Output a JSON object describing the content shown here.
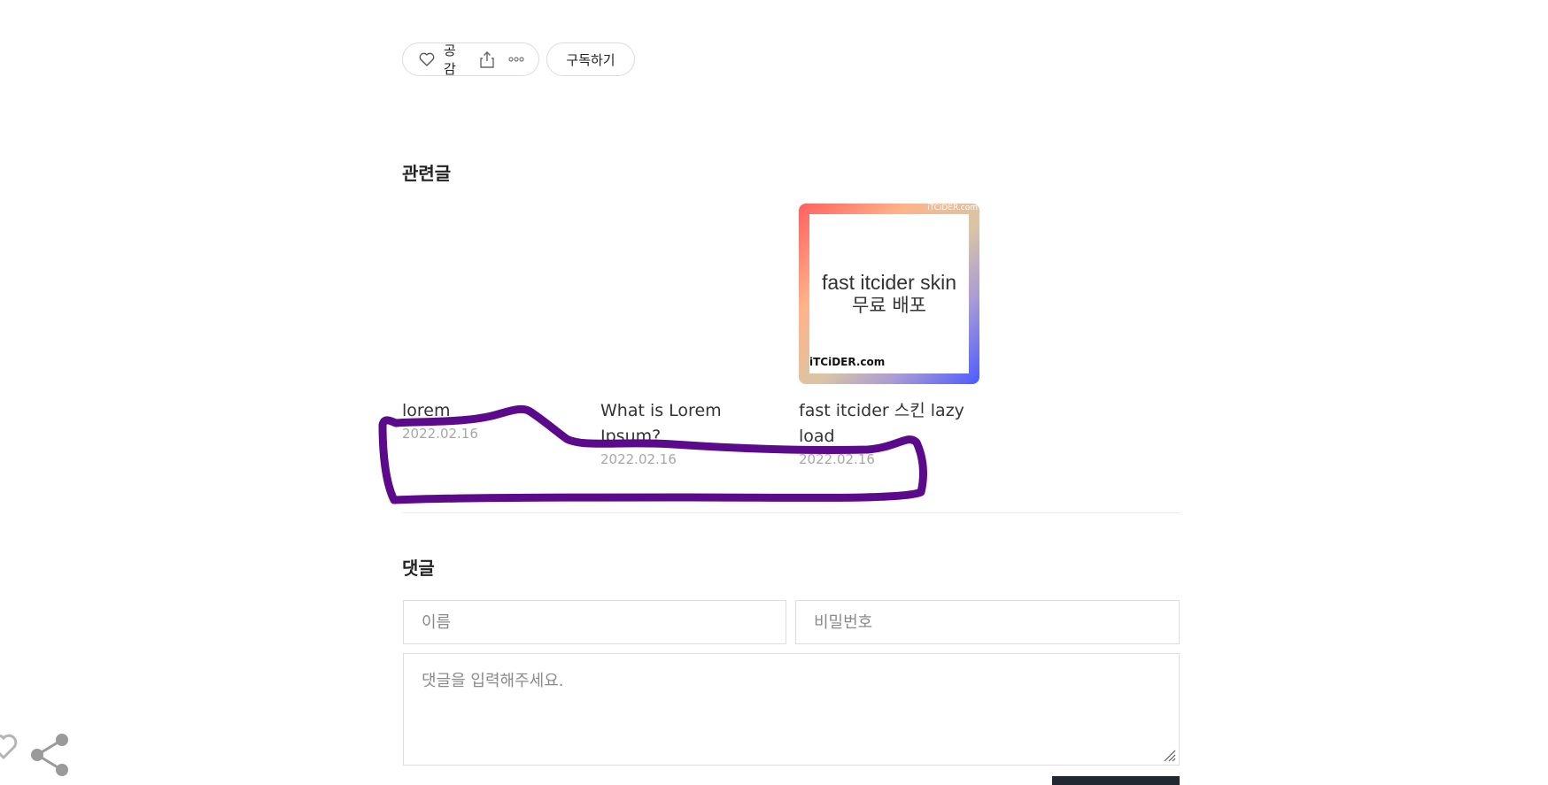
{
  "actions": {
    "like_label": "공감",
    "subscribe_label": "구독하기"
  },
  "related": {
    "title": "관련글",
    "items": [
      {
        "title": "lorem",
        "date": "2022.02.16",
        "has_thumbnail": false
      },
      {
        "title": "What is Lorem Ipsum?",
        "date": "2022.02.16",
        "has_thumbnail": false
      },
      {
        "title": "fast itcider 스킨 lazy load",
        "date": "2022.02.16",
        "has_thumbnail": true,
        "thumbnail": {
          "line1": "fast itcider skin",
          "line2": "무료 배포",
          "brand": "iTCiDER.com"
        }
      }
    ]
  },
  "comments": {
    "title": "댓글",
    "name_placeholder": "이름",
    "password_placeholder": "비밀번호",
    "textarea_placeholder": "댓글을 입력해주세요."
  },
  "colors": {
    "annotation_stroke": "#5a0a8a",
    "submit_button": "#222831",
    "date_text": "#a7a7a7"
  }
}
